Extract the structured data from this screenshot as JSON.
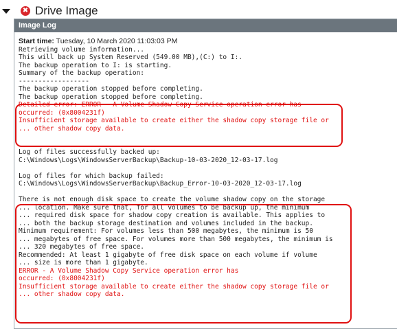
{
  "header": {
    "title": "Drive Image",
    "error_glyph": "✖"
  },
  "panel": {
    "title": "Image Log",
    "start_label": "Start time:",
    "start_value": "Tuesday, 10 March 2020 11:03:03 PM"
  },
  "log": {
    "block1": [
      "Retrieving volume information...",
      "This will back up System Reserved (549.00 MB),(C:) to I:.",
      "The backup operation to I: is starting.",
      "Summary of the backup operation:",
      "------------------",
      "The backup operation stopped before completing.",
      "The backup operation stopped before completing."
    ],
    "error1": [
      "Detailed error: ERROR - A Volume Shadow Copy Service operation error has",
      "occurred: (0x8004231f)",
      "Insufficient storage available to create either the shadow copy storage file or",
      "... other shadow copy data."
    ],
    "block2": [
      "Log of files successfully backed up:",
      "C:\\Windows\\Logs\\WindowsServerBackup\\Backup-10-03-2020_12-03-17.log"
    ],
    "block3": [
      "Log of files for which backup failed:",
      "C:\\Windows\\Logs\\WindowsServerBackup\\Backup_Error-10-03-2020_12-03-17.log"
    ],
    "block4": [
      "There is not enough disk space to create the volume shadow copy on the storage",
      "... location. Make sure that, for all volumes to be backup up, the minimum",
      "... required disk space for shadow copy creation is available. This applies to",
      "... both the backup storage destination and volumes included in the backup.",
      "Minimum requirement: For volumes less than 500 megabytes, the minimum is 50",
      "... megabytes of free space. For volumes more than 500 megabytes, the minimum is",
      "... 320 megabytes of free space.",
      "Recommended: At least 1 gigabyte of free disk space on each volume if volume",
      "... size is more than 1 gigabyte."
    ],
    "error2": [
      "ERROR - A Volume Shadow Copy Service operation error has",
      "occurred: (0x8004231f)",
      "Insufficient storage available to create either the shadow copy storage file or",
      "... other shadow copy data."
    ]
  },
  "colors": {
    "error_text": "#e01010",
    "highlight": "#e01010",
    "panel_title_bg": "#6b757d"
  }
}
